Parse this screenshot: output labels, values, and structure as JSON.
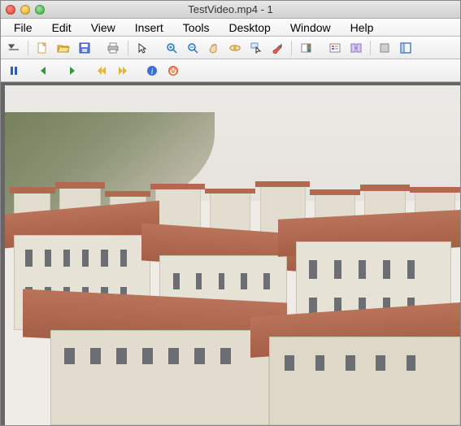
{
  "window": {
    "title": "TestVideo.mp4 - 1"
  },
  "menu": {
    "file": "File",
    "edit": "Edit",
    "view": "View",
    "insert": "Insert",
    "tools": "Tools",
    "desktop": "Desktop",
    "window": "Window",
    "help": "Help"
  },
  "toolbar1": {
    "dock": "dock-icon",
    "new": "new-file-icon",
    "open": "open-file-icon",
    "save": "save-icon",
    "print": "print-icon",
    "cursor": "cursor-icon",
    "zoom_in": "zoom-in-icon",
    "zoom_out": "zoom-out-icon",
    "pan": "pan-icon",
    "rotate": "rotate-3d-icon",
    "data_cursor": "data-cursor-icon",
    "brush": "brush-icon",
    "colorbar": "insert-colorbar-icon",
    "legend": "insert-legend-icon",
    "link": "link-plots-icon",
    "hide": "hide-plot-tools-icon",
    "show": "show-plot-tools-icon"
  },
  "toolbar2": {
    "pause": "pause-icon",
    "step_back": "step-back-icon",
    "play": "play-icon",
    "rewind": "rewind-icon",
    "forward": "fast-forward-icon",
    "info": "info-icon",
    "stop": "stop-icon"
  }
}
